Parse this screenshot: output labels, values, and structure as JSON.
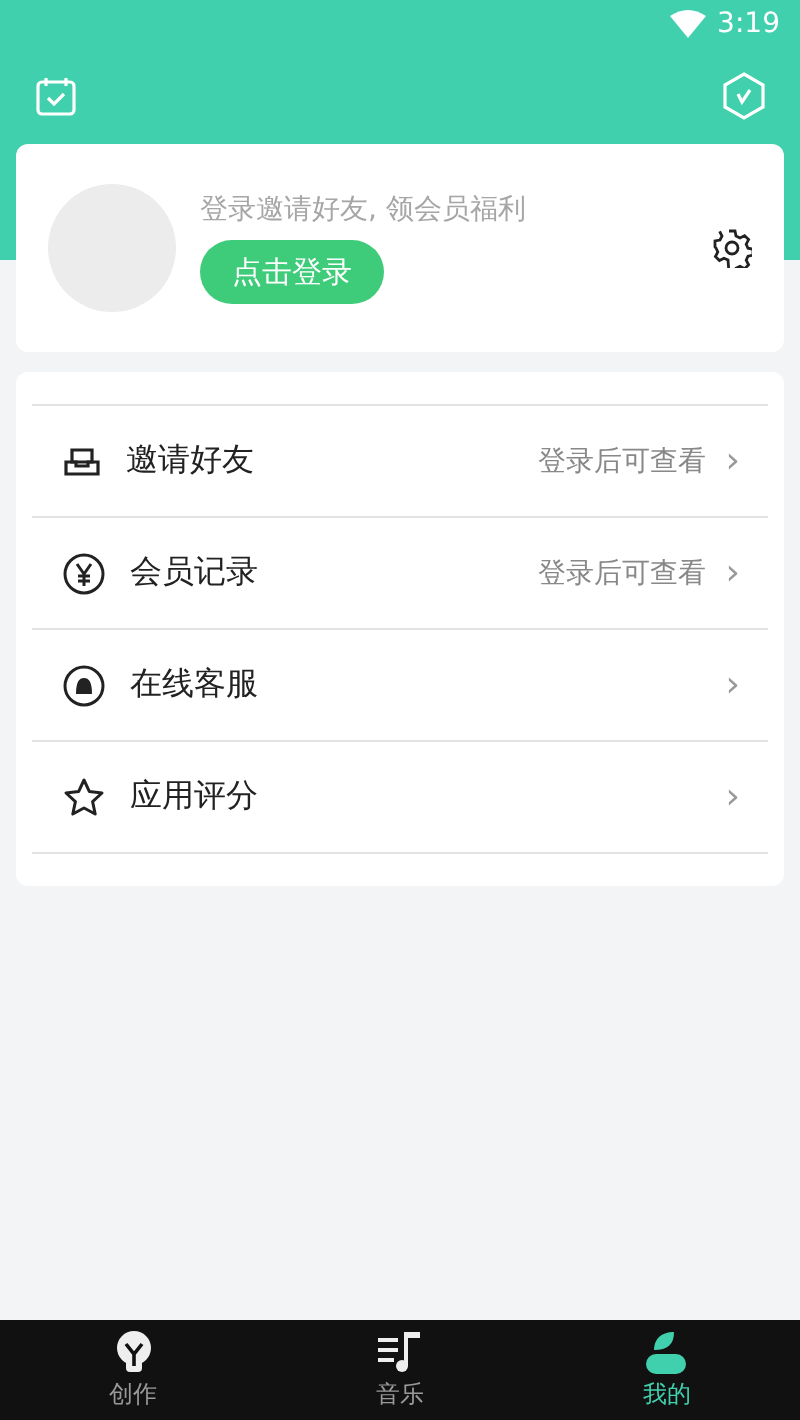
{
  "status_bar": {
    "time": "3:19"
  },
  "profile": {
    "prompt": "登录邀请好友, 领会员福利",
    "login_button": "点击登录"
  },
  "menu": [
    {
      "label": "邀请好友",
      "hint": "登录后可查看",
      "chevron": "›"
    },
    {
      "label": "会员记录",
      "hint": "登录后可查看",
      "chevron": "›"
    },
    {
      "label": "在线客服",
      "chevron": "›"
    },
    {
      "label": "应用评分",
      "chevron": "›"
    }
  ],
  "nav": [
    {
      "label": "创作",
      "selected": false
    },
    {
      "label": "音乐",
      "selected": false
    },
    {
      "label": "我的",
      "selected": true
    }
  ]
}
